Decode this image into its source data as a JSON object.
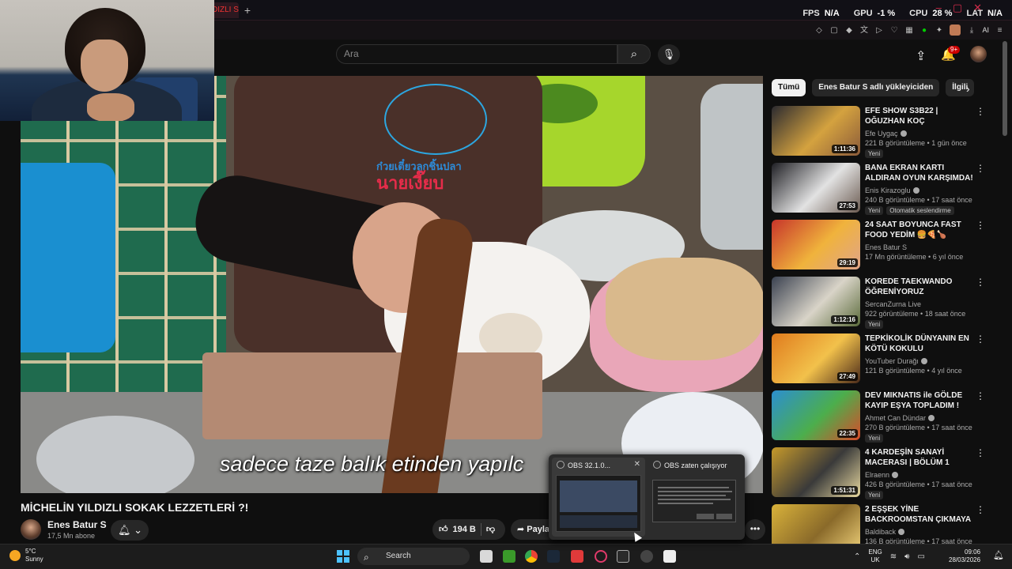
{
  "browser": {
    "active_tab_title": "DIZLI S",
    "new_tab_label": "+",
    "stats": [
      {
        "label": "FPS",
        "value": "N/A"
      },
      {
        "label": "GPU",
        "value": "-1 %"
      },
      {
        "label": "CPU",
        "value": "28 %"
      },
      {
        "label": "LAT",
        "value": "N/A"
      }
    ],
    "extension_ai_label": "AI"
  },
  "header": {
    "search_placeholder": "Ara",
    "search_icon": "search-icon",
    "mic_icon": "mic-icon",
    "upload_icon": "upload-icon",
    "bell_icon": "bell-icon",
    "notification_count": "9+"
  },
  "video": {
    "subtitle": "sadece taze balık etinden yapılc",
    "logo_text_blue": "ก๋วยเตี๋ยวลูกชิ้นปลา",
    "logo_text_red": "นายเงี๊ยบ",
    "title": "MİCHELİN YILDIZLI SOKAK LEZZETLERİ ?!",
    "channel_name": "Enes Batur S",
    "channel_subs": "17,5 Mn abone",
    "like_count": "194 B",
    "share_label": "Paylaş",
    "more_label": "•••"
  },
  "obs_popup": {
    "window1_title": "OBS 32.1.0...",
    "window2_title": "OBS zaten çalışıyor",
    "close_label": "✕"
  },
  "sidebar": {
    "chips": [
      "Tümü",
      "Enes Batur S adlı yükleyiciden",
      "İlgili"
    ],
    "active_chip": "Tümü",
    "recommendations": [
      {
        "title": "EFE SHOW S3B22 | OĞUZHAN KOÇ",
        "channel": "Efe Uygaç",
        "verified": true,
        "meta": "221 B görüntüleme • 1 gün önce",
        "badges": [
          "Yeni"
        ],
        "duration": "1:11:36",
        "colors": [
          "#2b2a30",
          "#d4a23f",
          "#8a5a3a"
        ]
      },
      {
        "title": "BANA EKRAN KARTI ALDIRAN OYUN KARŞIMDA!",
        "channel": "Enis Kirazoglu",
        "verified": true,
        "meta": "240 B görüntüleme • 17 saat önce",
        "badges": [
          "Yeni",
          "Otomatik seslendirme"
        ],
        "duration": "27:53",
        "colors": [
          "#1f1f24",
          "#e2e2e2",
          "#6a5a50"
        ]
      },
      {
        "title": "24 SAAT BOYUNCA FAST FOOD YEDİM 🍔🍕🍗",
        "channel": "Enes Batur S",
        "verified": false,
        "meta": "17 Mn görüntüleme • 6 yıl önce",
        "badges": [],
        "duration": "29:19",
        "colors": [
          "#c7352b",
          "#f0b33c",
          "#e0a48a"
        ]
      },
      {
        "title": "KOREDE TAEKWANDO ÖĞRENİYORUZ",
        "channel": "SercanZurna Live",
        "verified": false,
        "meta": "922 görüntüleme • 18 saat önce",
        "badges": [
          "Yeni"
        ],
        "duration": "1:12:16",
        "colors": [
          "#3a4150",
          "#d9d4c8",
          "#5a6a3a"
        ]
      },
      {
        "title": "TEPKİKOLİK DÜNYANIN EN KÖTÜ KOKULU YEMEKLERİNİ ...",
        "channel": "YouTuber Durağı",
        "verified": true,
        "meta": "121 B görüntüleme • 4 yıl önce",
        "badges": [],
        "duration": "27:49",
        "colors": [
          "#e07b1d",
          "#f2c14b",
          "#4a2a1a"
        ]
      },
      {
        "title": "DEV MIKNATIS ile GÖLDE KAYIP EŞYA TOPLADIM ! (S*lah ...",
        "channel": "Ahmet Can Dündar",
        "verified": true,
        "meta": "270 B görüntüleme • 17 saat önce",
        "badges": [
          "Yeni"
        ],
        "duration": "22:35",
        "colors": [
          "#2c8fd0",
          "#4cae4c",
          "#d84a2a"
        ]
      },
      {
        "title": "4 KARDEŞİN SANAYİ MACERASI | BÖLÜM 1",
        "channel": "Elraenn",
        "verified": true,
        "meta": "426 B görüntüleme • 17 saat önce",
        "badges": [
          "Yeni"
        ],
        "duration": "1:51:31",
        "colors": [
          "#c79a2a",
          "#3a3a3a",
          "#e8d9a0"
        ]
      },
      {
        "title": "2 EŞŞEK YİNE BACKROOMSTAN ÇIKMAYA ...",
        "channel": "Baldiback",
        "verified": true,
        "meta": "136 B görüntüleme • 17 saat önce",
        "badges": [],
        "duration": "",
        "colors": [
          "#d9b23a",
          "#8a6a2a",
          "#f0d27a"
        ]
      }
    ]
  },
  "taskbar": {
    "weather_temp": "5°C",
    "weather_text": "Sunny",
    "search_label": "Search",
    "lang1": "ENG",
    "lang2": "UK",
    "time": "09:06",
    "date": "28/03/2026"
  },
  "colors": {
    "background": "#0f0f0f",
    "accent_red": "#cc0000",
    "chip_active_bg": "#f1f1f1"
  }
}
